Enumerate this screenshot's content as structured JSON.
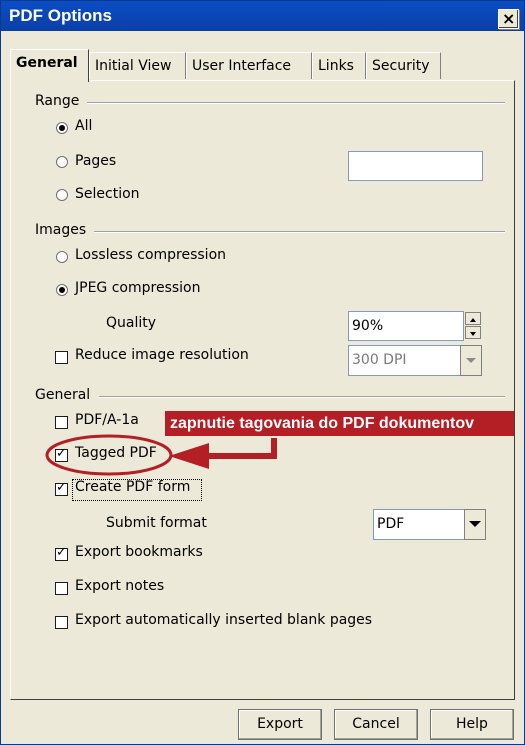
{
  "window": {
    "title": "PDF Options",
    "close_glyph": "×"
  },
  "tabs": [
    {
      "label": "General",
      "active": true
    },
    {
      "label": "Initial View",
      "active": false
    },
    {
      "label": "User Interface",
      "active": false
    },
    {
      "label": "Links",
      "active": false
    },
    {
      "label": "Security",
      "active": false
    }
  ],
  "range": {
    "heading": "Range",
    "all_label": "All",
    "pages_label": "Pages",
    "pages_value": "",
    "selection_label": "Selection",
    "selected": "all"
  },
  "images": {
    "heading": "Images",
    "lossless_label": "Lossless compression",
    "jpeg_label": "JPEG compression",
    "selected": "jpeg",
    "quality_label": "Quality",
    "quality_value": "90%",
    "reduce_label": "Reduce image resolution",
    "reduce_checked": false,
    "resolution_value": "300 DPI"
  },
  "general": {
    "heading": "General",
    "pdfa_label": "PDF/A-1a",
    "pdfa_checked": false,
    "tagged_label": "Tagged PDF",
    "tagged_checked": true,
    "form_label": "Create PDF form",
    "form_checked": true,
    "submit_label": "Submit format",
    "submit_value": "PDF",
    "bookmarks_label": "Export bookmarks",
    "bookmarks_checked": true,
    "notes_label": "Export notes",
    "notes_checked": false,
    "blank_label": "Export automatically inserted blank pages",
    "blank_checked": false
  },
  "annotation": {
    "text": "zapnutie tagovania do PDF dokumentov",
    "color": "#b31f24"
  },
  "buttons": {
    "export": "Export",
    "cancel": "Cancel",
    "help": "Help"
  },
  "icons": {
    "check": "checkmark-icon",
    "arrow": "left-arrow-icon",
    "close": "close-icon"
  }
}
